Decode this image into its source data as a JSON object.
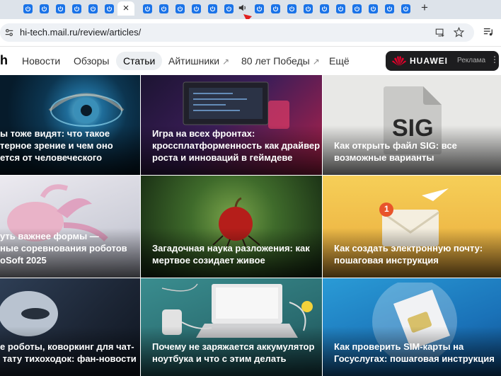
{
  "browser": {
    "close_tab_glyph": "×",
    "new_tab_glyph": "+",
    "url": "hi-tech.mail.ru/review/articles/"
  },
  "site": {
    "logo_fragment": "h",
    "nav": [
      {
        "label": "Новости",
        "active": false,
        "external": false
      },
      {
        "label": "Обзоры",
        "active": false,
        "external": false
      },
      {
        "label": "Статьи",
        "active": true,
        "external": false
      },
      {
        "label": "Айтишники",
        "active": false,
        "external": true
      },
      {
        "label": "80 лет Победы",
        "active": false,
        "external": true
      },
      {
        "label": "Ещё",
        "active": false,
        "external": false
      }
    ],
    "external_glyph": "↗",
    "ad": {
      "brand": "HUAWEI",
      "label": "Реклама",
      "menu_glyph": "⋮"
    }
  },
  "articles": [
    {
      "title": "ы тоже видят: что такое\nтерное зрение и чем оно\nется от человеческого"
    },
    {
      "title": "Игра на всех фронтах:\nкроссплатформенность как драйвер\nроста и инноваций в геймдеве"
    },
    {
      "title": "Как открыть файл SIG: все\nвозможные варианты",
      "image_text": "SIG"
    },
    {
      "title": "уть важнее формы —\nные соревнования роботов\noSoft 2025"
    },
    {
      "title": "Загадочная наука разложения: как\nмертвое созидает живое"
    },
    {
      "title": "Как создать электронную почту:\nпошаговая инструкция",
      "image_text": "1"
    },
    {
      "title": "е роботы, коворкинг для чат-\n тату тихоходок: фан-новости"
    },
    {
      "title": "Почему не заряжается аккумулятор\nноутбука и что с этим делать"
    },
    {
      "title": "Как проверить SIM-карты на\nГосуслугах: пошаговая инструкция"
    }
  ],
  "colors": {
    "tab_strip": "#dde3ea",
    "favicon_blue": "#1a73e8",
    "annotation_red": "#e02020",
    "ad_bg": "#1d1d1f"
  }
}
